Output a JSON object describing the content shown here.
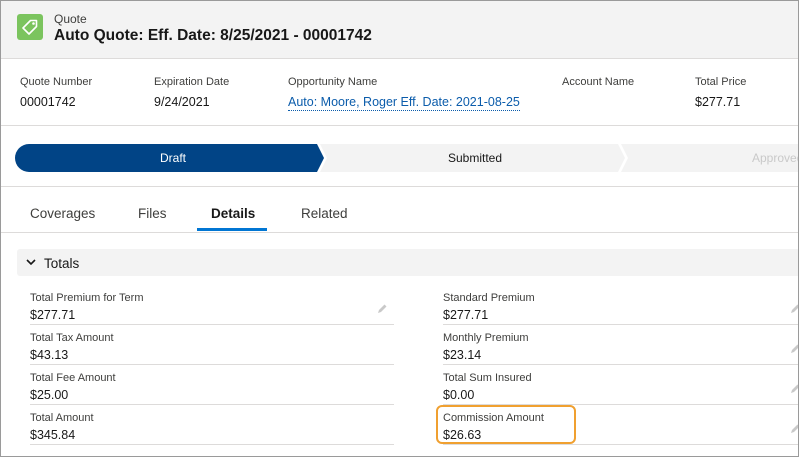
{
  "header": {
    "object_label": "Quote",
    "record_title": "Auto Quote: Eff. Date: 8/25/2021 - 00001742",
    "icon": "quote-tag-icon",
    "icon_color": "#7bc45e"
  },
  "highlights": [
    {
      "label": "Quote Number",
      "value": "00001742"
    },
    {
      "label": "Expiration Date",
      "value": "9/24/2021"
    },
    {
      "label": "Opportunity Name",
      "value": "Auto: Moore, Roger Eff. Date: 2021-08-25"
    },
    {
      "label": "Account Name",
      "value": ""
    },
    {
      "label": "Total Price",
      "value": "$277.71"
    }
  ],
  "path": {
    "stages": [
      "Draft",
      "Submitted",
      "Approved"
    ],
    "current": "Draft",
    "current_color": "#014486"
  },
  "tabs": [
    "Coverages",
    "Files",
    "Details",
    "Related"
  ],
  "active_tab": "Details",
  "section": {
    "title": "Totals",
    "left_fields": [
      {
        "label": "Total Premium for Term",
        "value": "$277.71"
      },
      {
        "label": "Total Tax Amount",
        "value": "$43.13"
      },
      {
        "label": "Total Fee Amount",
        "value": "$25.00"
      },
      {
        "label": "Total Amount",
        "value": "$345.84"
      }
    ],
    "right_fields": [
      {
        "label": "Standard Premium",
        "value": "$277.71"
      },
      {
        "label": "Monthly Premium",
        "value": "$23.14"
      },
      {
        "label": "Total Sum Insured",
        "value": "$0.00"
      },
      {
        "label": "Commission Amount",
        "value": "$26.63"
      }
    ]
  },
  "highlight_box_color": "#f0a030"
}
